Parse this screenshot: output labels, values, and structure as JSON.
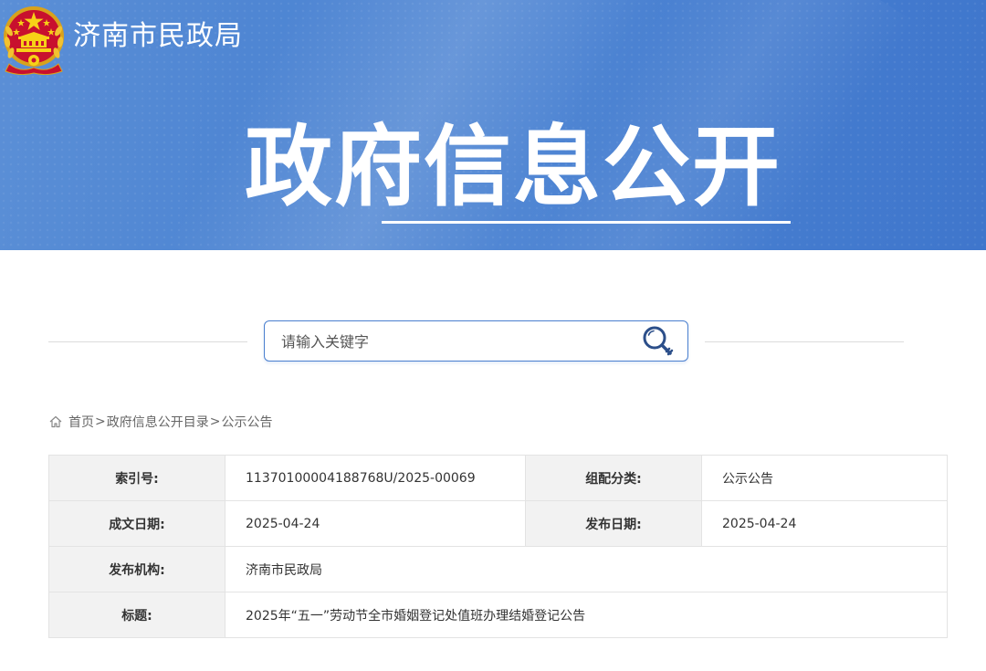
{
  "header": {
    "site_name": "济南市民政局",
    "banner_title": "政府信息公开"
  },
  "search": {
    "placeholder": "请输入关键字"
  },
  "breadcrumb": {
    "home": "首页",
    "separator": ">",
    "catalog": "政府信息公开目录",
    "current": "公示公告"
  },
  "info": {
    "index_label": "索引号:",
    "index_value": "11370100004188768U/2025-00069",
    "category_label": "组配分类:",
    "category_value": "公示公告",
    "created_label": "成文日期:",
    "created_value": "2025-04-24",
    "published_label": "发布日期:",
    "published_value": "2025-04-24",
    "org_label": "发布机构:",
    "org_value": "济南市民政局",
    "title_label": "标题:",
    "title_value": "2025年“五一”劳动节全市婚姻登记处值班办理结婚登记公告"
  },
  "colors": {
    "banner": "#4a82d2",
    "search_border": "#4a7fcf",
    "label_bg": "#f2f2f2"
  },
  "icons": [
    "national-emblem-icon",
    "search-key-icon",
    "home-icon"
  ]
}
